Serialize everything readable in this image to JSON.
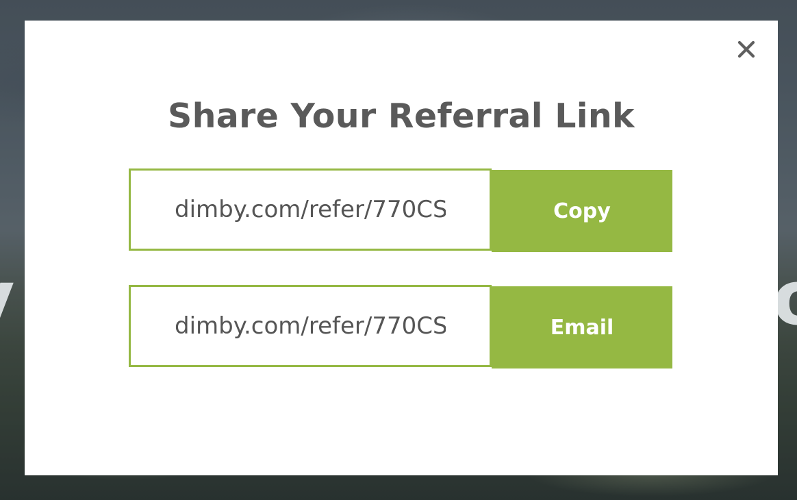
{
  "modal": {
    "title": "Share Your Referral Link",
    "close_icon": "close-icon",
    "rows": [
      {
        "link_value": "dimby.com/refer/770CS",
        "button_label": "Copy"
      },
      {
        "link_value": "dimby.com/refer/770CS",
        "button_label": "Email"
      }
    ]
  },
  "colors": {
    "accent": "#95b843",
    "title_text": "#5a5a5a",
    "field_text": "#555555",
    "modal_bg": "#ffffff"
  }
}
